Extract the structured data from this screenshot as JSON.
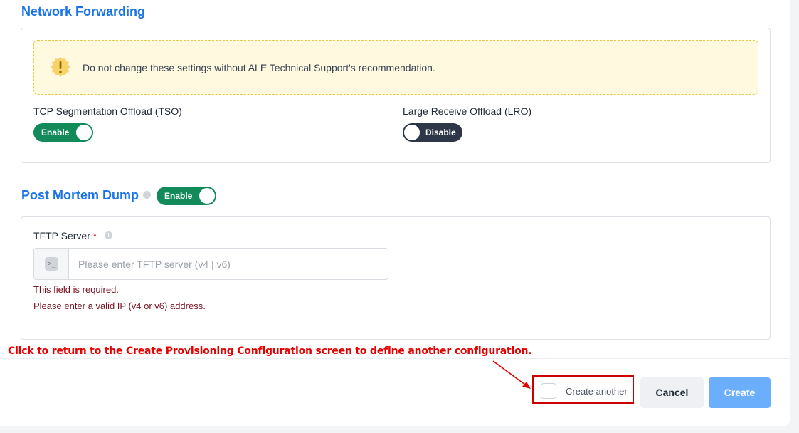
{
  "network_forwarding": {
    "title": "Network Forwarding",
    "warning": "Do not change these settings without ALE Technical Support's recommendation.",
    "tso": {
      "label": "TCP Segmentation Offload (TSO)",
      "state": "Enable"
    },
    "lro": {
      "label": "Large Receive Offload (LRO)",
      "state": "Disable"
    }
  },
  "post_mortem": {
    "title": "Post Mortem Dump",
    "toggle_state": "Enable",
    "tftp": {
      "label": "TFTP Server",
      "required_mark": "*",
      "placeholder": "Please enter TFTP server (v4 | v6)",
      "value": "",
      "errors": [
        "This field is required.",
        "Please enter a valid IP (v4 or v6) address."
      ]
    }
  },
  "annotation": "Click to return to the Create Provisioning Configuration screen to define another configuration.",
  "footer": {
    "create_another_label": "Create another",
    "cancel_label": "Cancel",
    "create_label": "Create"
  },
  "icons": {
    "warning": "warning-icon",
    "info": "info-icon",
    "terminal": "terminal-icon",
    "arrow": "annotation-arrow"
  },
  "colors": {
    "accent_blue": "#1a73e8",
    "toggle_on": "#138a5a",
    "toggle_off": "#2d3748",
    "error_text": "#7a1020",
    "annotation_red": "#e60000",
    "create_button": "#6aaefc"
  }
}
